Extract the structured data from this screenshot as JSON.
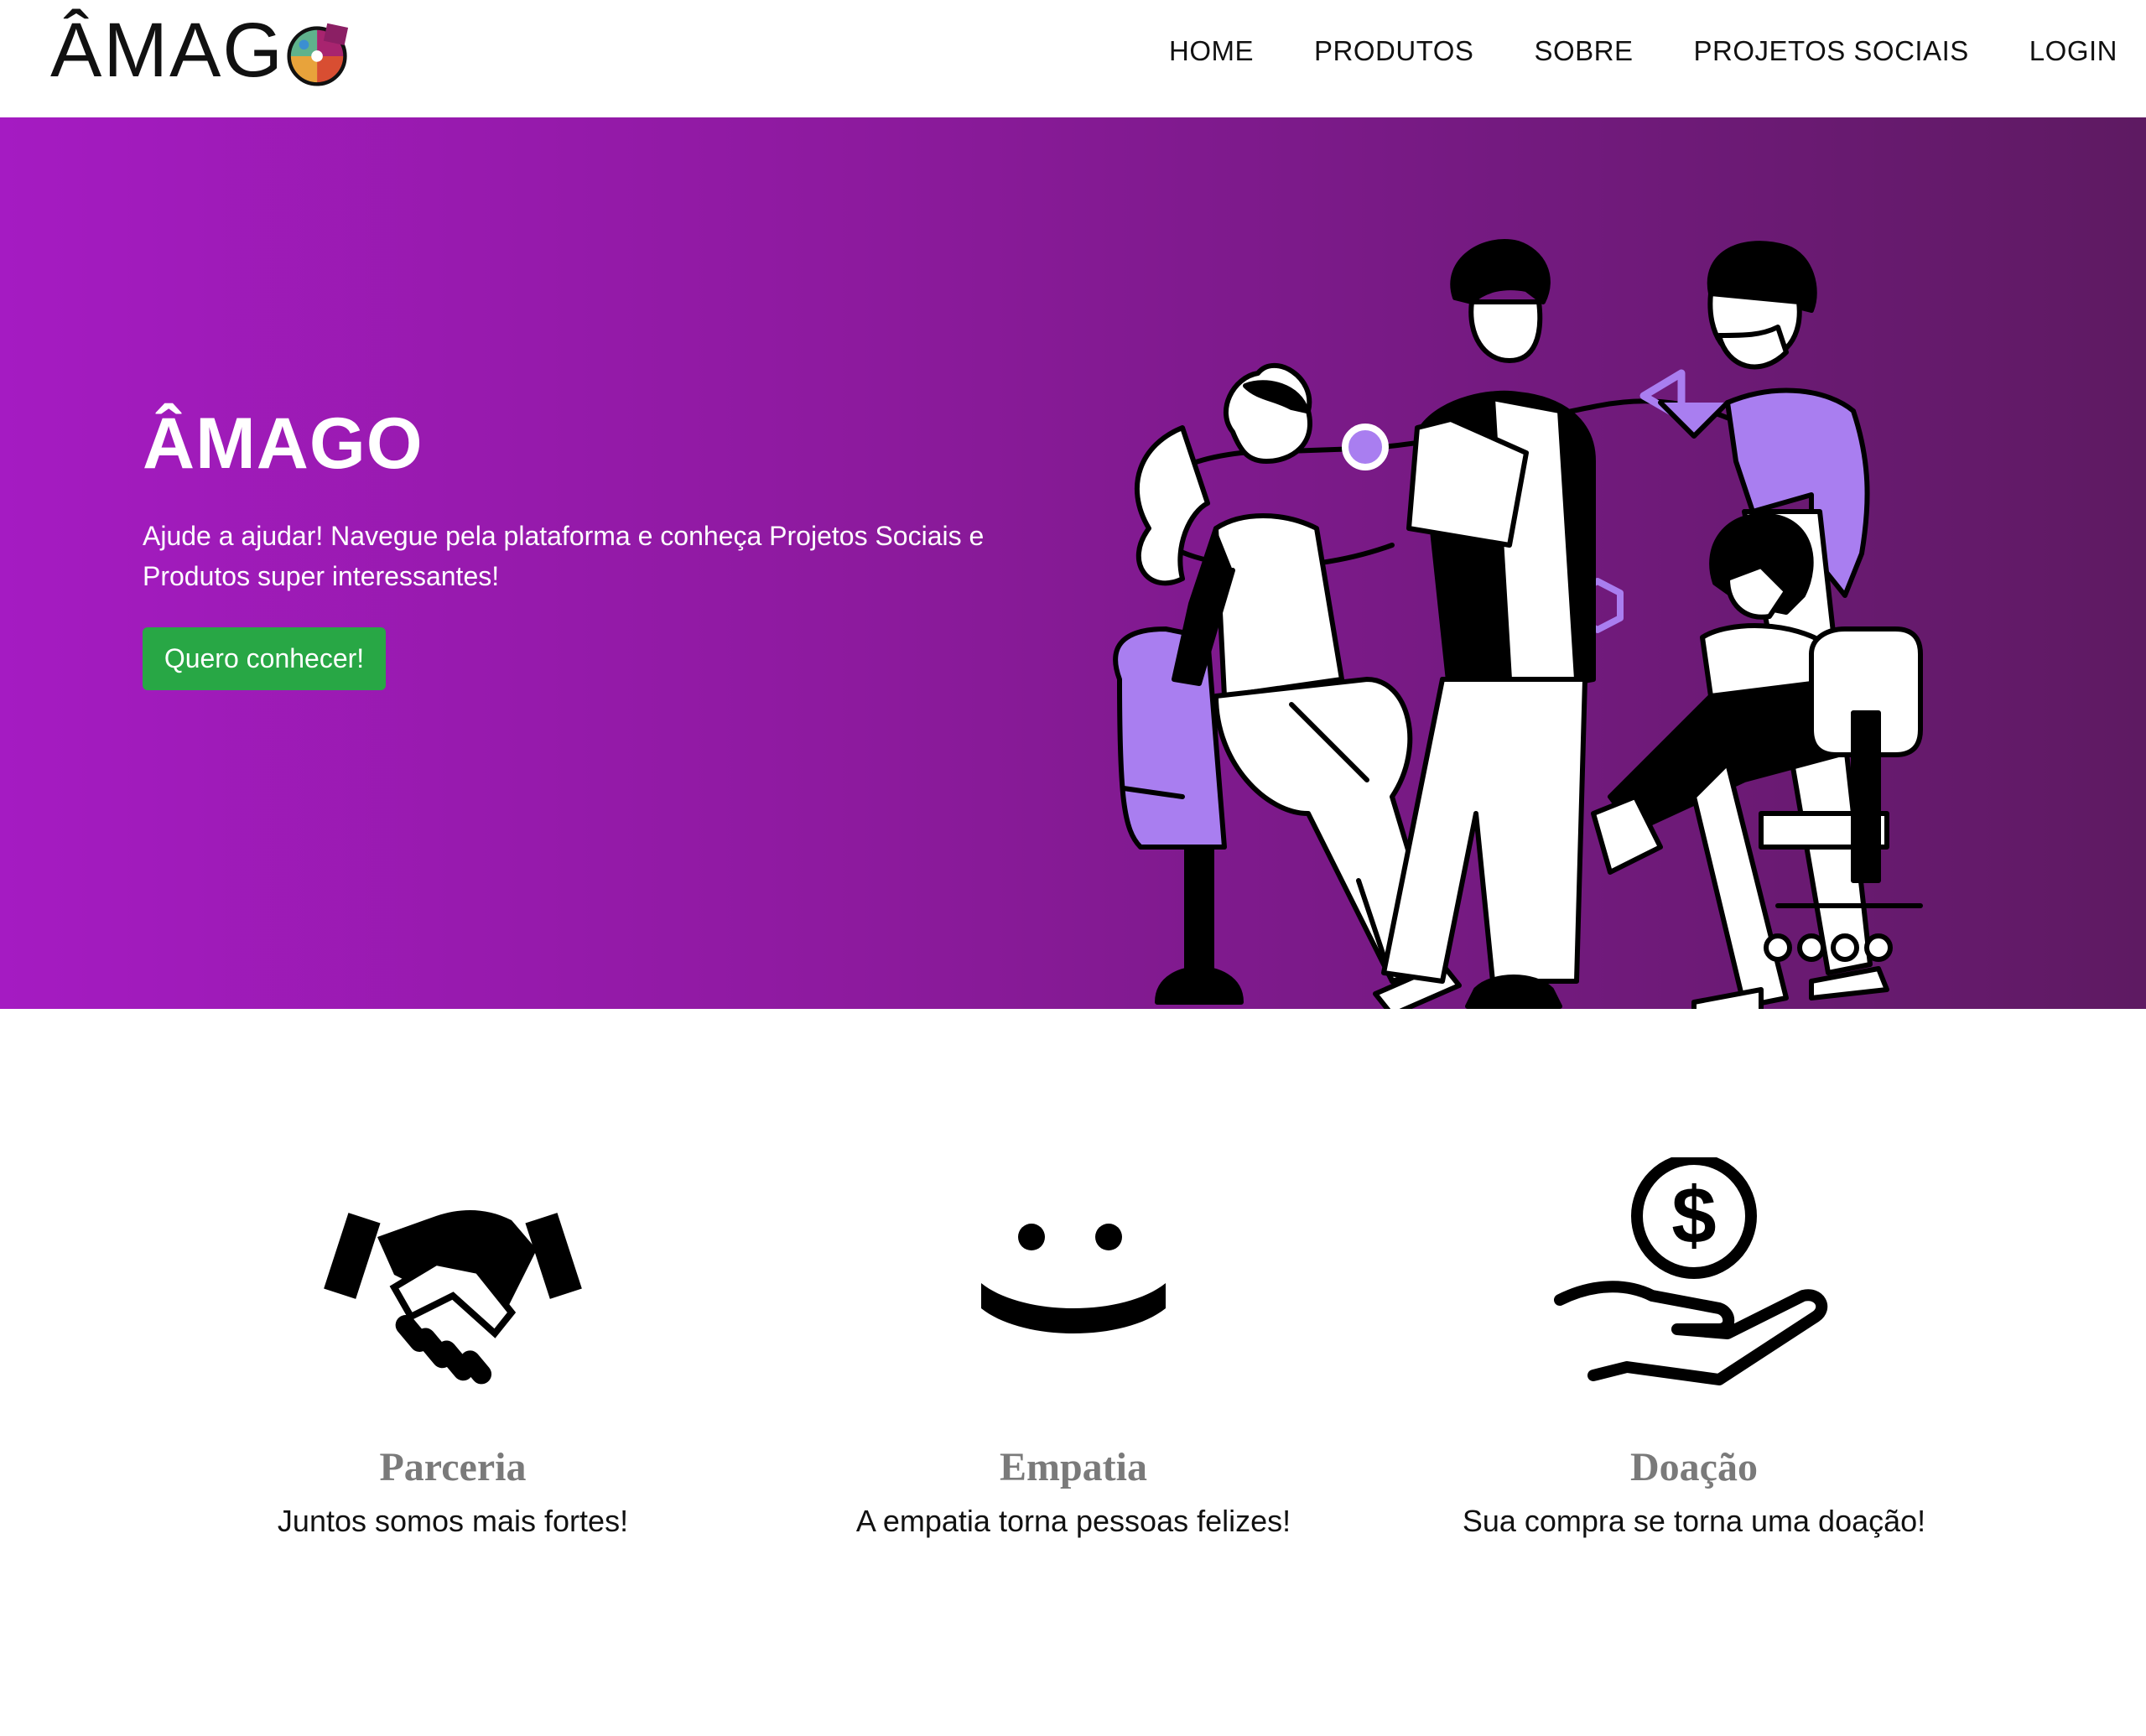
{
  "brand": {
    "name": "ÂMAG",
    "colors": [
      "#a8246f",
      "#5fb28c",
      "#e8a33b",
      "#d84e32",
      "#3b8fd1"
    ]
  },
  "nav": {
    "items": [
      "HOME",
      "PRODUTOS",
      "SOBRE",
      "PROJETOS SOCIAIS",
      "LOGIN"
    ]
  },
  "hero": {
    "title": "ÂMAGO",
    "text": "Ajude a ajudar! Navegue pela plataforma e conheça Projetos Sociais e Produtos super interessantes!",
    "button": "Quero conhecer!",
    "gradient": [
      "#a51bc2",
      "#5e1a62"
    ],
    "accent": "#a97ef0"
  },
  "features": [
    {
      "icon": "handshake-icon",
      "title": "Parceria",
      "text": "Juntos somos mais fortes!"
    },
    {
      "icon": "smile-icon",
      "title": "Empatia",
      "text": "A empatia torna pessoas felizes!"
    },
    {
      "icon": "donation-hand-icon",
      "title": "Doação",
      "text": "Sua compra se torna uma doação!"
    }
  ]
}
